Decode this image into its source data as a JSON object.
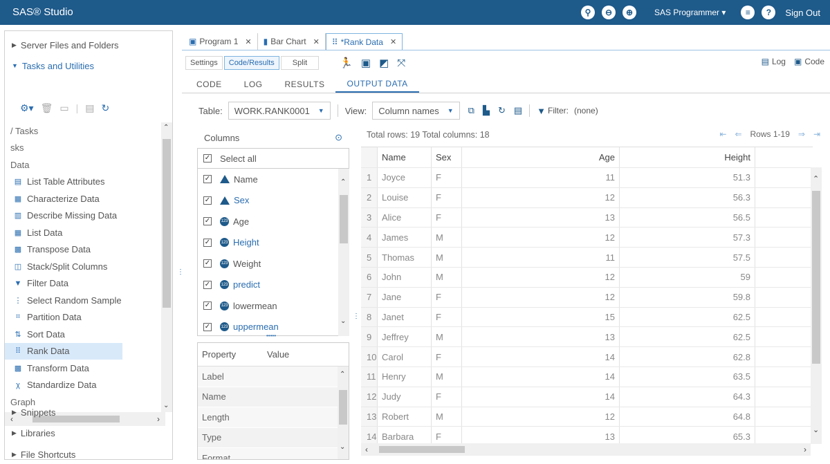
{
  "topbar": {
    "title": "SAS® Studio",
    "user": "SAS Programmer ▾",
    "signout": "Sign Out"
  },
  "left": {
    "sections": {
      "server": "Server Files and Folders",
      "tasks": "Tasks and Utilities",
      "snippets": "Snippets",
      "libraries": "Libraries",
      "shortcuts": "File Shortcuts"
    },
    "tasks": [
      {
        "label": "/ Tasks",
        "cat": true
      },
      {
        "label": "sks",
        "cat": true
      },
      {
        "label": "Data",
        "cat": true
      },
      {
        "label": "List Table Attributes",
        "icon": "table-attributes-icon",
        "glyph": "▤"
      },
      {
        "label": "Characterize Data",
        "icon": "characterize-icon",
        "glyph": "▦"
      },
      {
        "label": "Describe Missing Data",
        "icon": "missing-data-icon",
        "glyph": "▥"
      },
      {
        "label": "List Data",
        "icon": "list-data-icon",
        "glyph": "▦"
      },
      {
        "label": "Transpose Data",
        "icon": "transpose-icon",
        "glyph": "▩"
      },
      {
        "label": "Stack/Split Columns",
        "icon": "stack-split-icon",
        "glyph": "◫"
      },
      {
        "label": "Filter Data",
        "icon": "filter-icon",
        "glyph": "▼"
      },
      {
        "label": "Select Random Sample",
        "icon": "random-sample-icon",
        "glyph": "⋮"
      },
      {
        "label": "Partition Data",
        "icon": "partition-icon",
        "glyph": "⌗"
      },
      {
        "label": "Sort Data",
        "icon": "sort-icon",
        "glyph": "⇅"
      },
      {
        "label": "Rank Data",
        "icon": "rank-icon",
        "glyph": "⠿",
        "selected": true
      },
      {
        "label": "Transform Data",
        "icon": "transform-icon",
        "glyph": "▩"
      },
      {
        "label": "Standardize Data",
        "icon": "standardize-icon",
        "glyph": "χ"
      },
      {
        "label": "Graph",
        "cat": true
      }
    ]
  },
  "tabs": [
    {
      "label": "Program 1",
      "icon": "program-icon",
      "glyph": "▣"
    },
    {
      "label": "Bar Chart",
      "icon": "bar-chart-icon",
      "glyph": "▮"
    },
    {
      "label": "*Rank Data",
      "icon": "rank-icon",
      "glyph": "⠿",
      "active": true
    }
  ],
  "toolbar": {
    "settings": "Settings",
    "code_results": "Code/Results",
    "split": "Split",
    "log": "Log",
    "code": "Code"
  },
  "subtabs": [
    "CODE",
    "LOG",
    "RESULTS",
    "OUTPUT DATA"
  ],
  "tablebar": {
    "table_label": "Table:",
    "table_value": "WORK.RANK0001",
    "view_label": "View:",
    "view_value": "Column names",
    "filter_label": "Filter:",
    "filter_value": "(none)"
  },
  "columns_panel": {
    "title": "Columns",
    "select_all": "Select all",
    "items": [
      {
        "name": "Name",
        "type": "char",
        "highlight": false
      },
      {
        "name": "Sex",
        "type": "char",
        "highlight": true
      },
      {
        "name": "Age",
        "type": "num",
        "highlight": false
      },
      {
        "name": "Height",
        "type": "num",
        "highlight": true
      },
      {
        "name": "Weight",
        "type": "num",
        "highlight": false
      },
      {
        "name": "predict",
        "type": "num",
        "highlight": true
      },
      {
        "name": "lowermean",
        "type": "num",
        "highlight": false
      },
      {
        "name": "uppermean",
        "type": "num",
        "highlight": true
      }
    ]
  },
  "properties": {
    "header_property": "Property",
    "header_value": "Value",
    "rows": [
      "Label",
      "Name",
      "Length",
      "Type",
      "Format"
    ]
  },
  "grid": {
    "info": "Total rows: 19  Total columns: 18",
    "rows_range": "Rows 1-19",
    "headers": [
      "Name",
      "Sex",
      "Age",
      "Height"
    ],
    "rows": [
      [
        "1",
        "Joyce",
        "F",
        "11",
        "51.3"
      ],
      [
        "2",
        "Louise",
        "F",
        "12",
        "56.3"
      ],
      [
        "3",
        "Alice",
        "F",
        "13",
        "56.5"
      ],
      [
        "4",
        "James",
        "M",
        "12",
        "57.3"
      ],
      [
        "5",
        "Thomas",
        "M",
        "11",
        "57.5"
      ],
      [
        "6",
        "John",
        "M",
        "12",
        "59"
      ],
      [
        "7",
        "Jane",
        "F",
        "12",
        "59.8"
      ],
      [
        "8",
        "Janet",
        "F",
        "15",
        "62.5"
      ],
      [
        "9",
        "Jeffrey",
        "M",
        "13",
        "62.5"
      ],
      [
        "10",
        "Carol",
        "F",
        "14",
        "62.8"
      ],
      [
        "11",
        "Henry",
        "M",
        "14",
        "63.5"
      ],
      [
        "12",
        "Judy",
        "F",
        "14",
        "64.3"
      ],
      [
        "13",
        "Robert",
        "M",
        "12",
        "64.8"
      ],
      [
        "14",
        "Barbara",
        "F",
        "13",
        "65.3"
      ]
    ]
  }
}
